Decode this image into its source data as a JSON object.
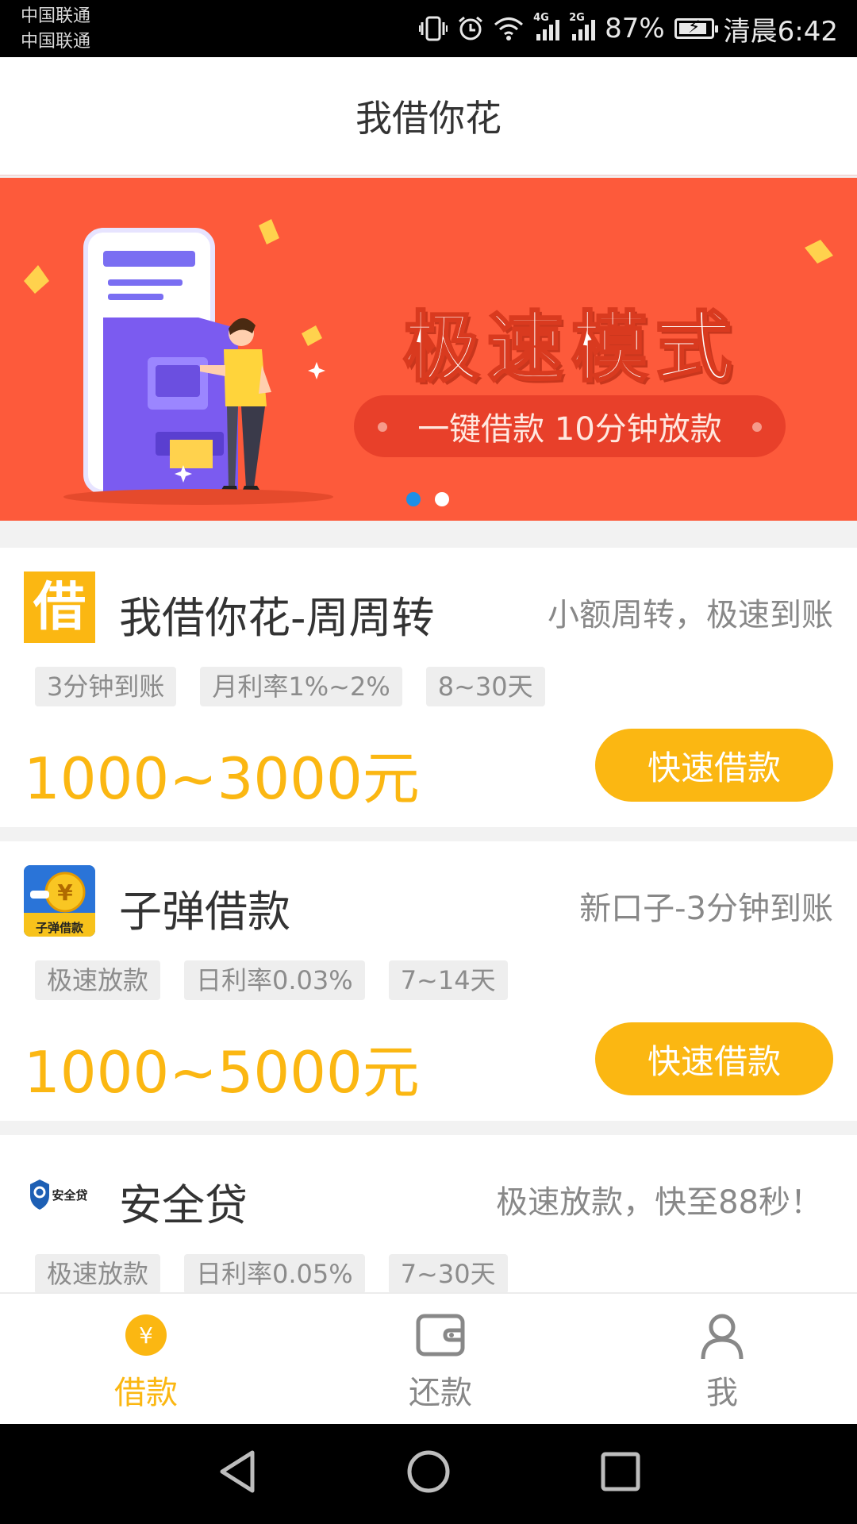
{
  "status_bar": {
    "carrier_1": "中国联通",
    "carrier_2": "中国联通",
    "net_1": "4G",
    "net_2": "2G",
    "battery": "87%",
    "time": "清晨6:42"
  },
  "header": {
    "title": "我借你花"
  },
  "banner": {
    "title": "极速模式",
    "subtitle": "一键借款  10分钟放款",
    "pages": 2,
    "active_page": 1
  },
  "loans": [
    {
      "logo_char": "借",
      "name": "我借你花-周周转",
      "slogan": "小额周转，极速到账",
      "tags": [
        "3分钟到账",
        "月利率1%~2%",
        "8~30天"
      ],
      "amount": "1000~3000元",
      "button": "快速借款"
    },
    {
      "logo_text": "子弹借款",
      "logo_symbol": "¥",
      "name": "子弹借款",
      "slogan": "新口子-3分钟到账",
      "tags": [
        "极速放款",
        "日利率0.03%",
        "7~14天"
      ],
      "amount": "1000~5000元",
      "button": "快速借款"
    },
    {
      "logo_text": "安全贷",
      "name": "安全贷",
      "slogan": "极速放款，快至88秒！",
      "tags": [
        "极速放款",
        "日利率0.05%",
        "7~30天"
      ]
    }
  ],
  "bottom_nav": {
    "borrow": {
      "label": "借款",
      "symbol": "¥"
    },
    "repay": {
      "label": "还款"
    },
    "me": {
      "label": "我"
    }
  },
  "colors": {
    "accent": "#fbb712",
    "banner_bg": "#fd5a3b",
    "pager_active": "#1e8fe6"
  }
}
